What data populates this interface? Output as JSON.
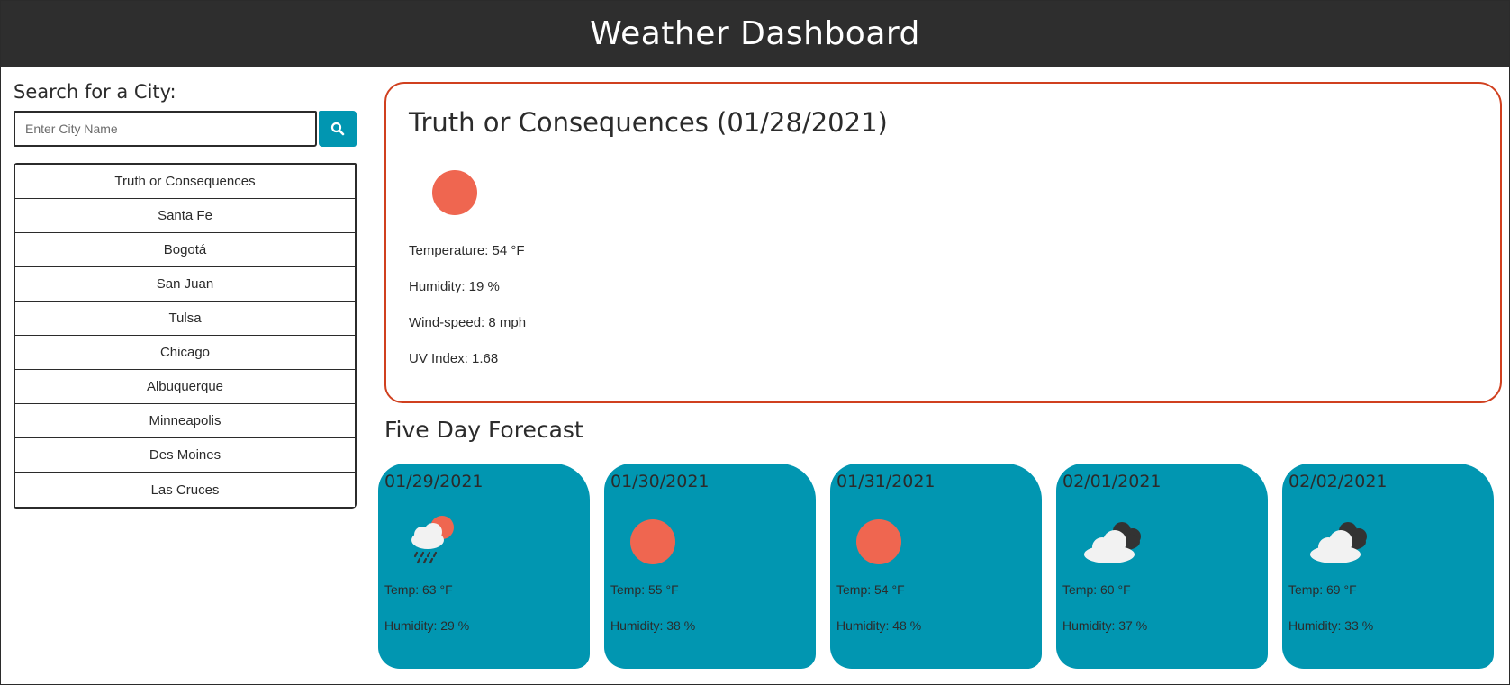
{
  "header": {
    "title": "Weather Dashboard"
  },
  "search": {
    "heading": "Search for a City:",
    "placeholder": "Enter City Name",
    "value": ""
  },
  "history": [
    "Truth or Consequences",
    "Santa Fe",
    "Bogotá",
    "San Juan",
    "Tulsa",
    "Chicago",
    "Albuquerque",
    "Minneapolis",
    "Des Moines",
    "Las Cruces"
  ],
  "current": {
    "title": "Truth or Consequences (01/28/2021)",
    "icon": "sun-icon",
    "temperature": "Temperature: 54 °F",
    "humidity": "Humidity: 19 %",
    "wind": "Wind-speed: 8 mph",
    "uv": "UV Index: 1.68"
  },
  "forecast": {
    "title": "Five Day Forecast",
    "days": [
      {
        "date": "01/29/2021",
        "icon": "sun-rain-cloud-icon",
        "temp": "Temp: 63 °F",
        "humidity": "Humidity: 29 %"
      },
      {
        "date": "01/30/2021",
        "icon": "sun-icon",
        "temp": "Temp: 55 °F",
        "humidity": "Humidity: 38 %"
      },
      {
        "date": "01/31/2021",
        "icon": "sun-icon",
        "temp": "Temp: 54 °F",
        "humidity": "Humidity: 48 %"
      },
      {
        "date": "02/01/2021",
        "icon": "broken-clouds-icon",
        "temp": "Temp: 60 °F",
        "humidity": "Humidity: 37 %"
      },
      {
        "date": "02/02/2021",
        "icon": "broken-clouds-icon",
        "temp": "Temp: 69 °F",
        "humidity": "Humidity: 33 %"
      }
    ]
  },
  "colors": {
    "header_bg": "#2e2e2e",
    "accent": "#0196b1",
    "current_border": "#d0401f",
    "sun": "#ef6650"
  }
}
